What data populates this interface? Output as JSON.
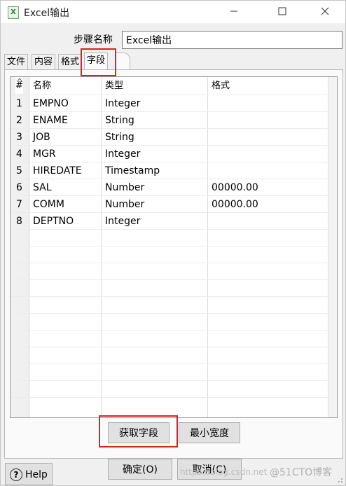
{
  "window": {
    "title": "Excel输出",
    "icon": "excel-file-icon"
  },
  "step_name": {
    "label": "步骤名称",
    "value": "Excel输出"
  },
  "tabs": [
    {
      "label": "文件"
    },
    {
      "label": "内容"
    },
    {
      "label": "格式"
    },
    {
      "label": "字段",
      "active": true
    }
  ],
  "table": {
    "headers": {
      "num": "#",
      "name": "名称",
      "type": "类型",
      "format": "格式"
    },
    "rows": [
      {
        "num": "1",
        "name": "EMPNO",
        "type": "Integer",
        "format": ""
      },
      {
        "num": "2",
        "name": "ENAME",
        "type": "String",
        "format": ""
      },
      {
        "num": "3",
        "name": "JOB",
        "type": "String",
        "format": ""
      },
      {
        "num": "4",
        "name": "MGR",
        "type": "Integer",
        "format": ""
      },
      {
        "num": "5",
        "name": "HIREDATE",
        "type": "Timestamp",
        "format": ""
      },
      {
        "num": "6",
        "name": "SAL",
        "type": "Number",
        "format": "00000.00"
      },
      {
        "num": "7",
        "name": "COMM",
        "type": "Number",
        "format": "00000.00"
      },
      {
        "num": "8",
        "name": "DEPTNO",
        "type": "Integer",
        "format": ""
      }
    ]
  },
  "buttons": {
    "get_fields": "获取字段",
    "min_width": "最小宽度",
    "ok": "确定(O)",
    "cancel": "取消(C)",
    "help": "Help"
  },
  "watermark": {
    "url": "https://blog.csdn.net",
    "brand": "@51CTO博客"
  },
  "colors": {
    "highlight": "#e0201a"
  }
}
